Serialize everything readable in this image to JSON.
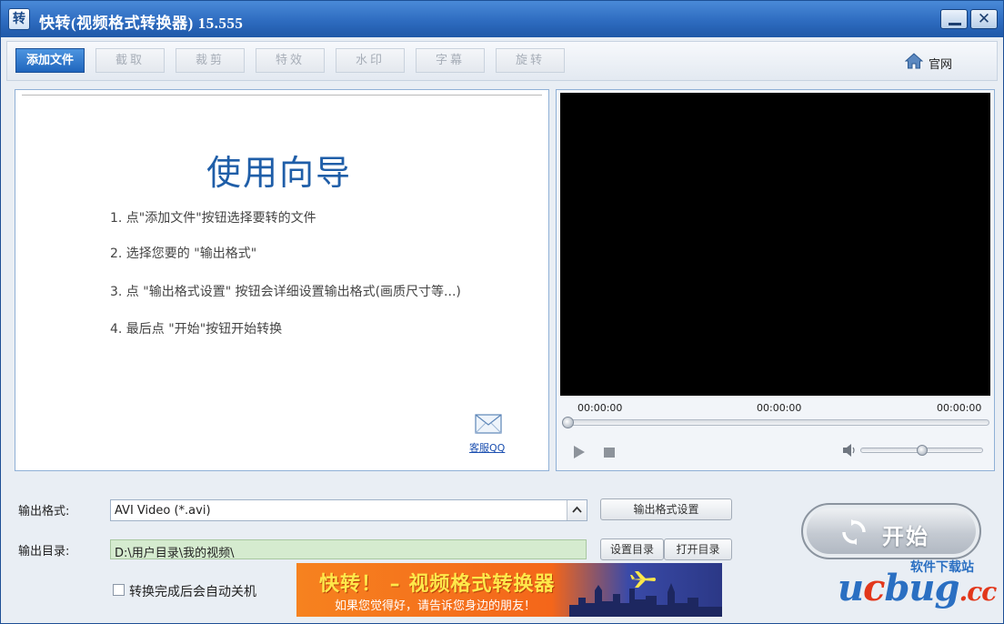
{
  "window": {
    "title": "快转(视频格式转换器) 15.555",
    "icon_glyph": "转"
  },
  "toolbar": {
    "add_file": "添加文件",
    "clip": "截取",
    "crop": "裁剪",
    "effects": "特效",
    "watermark": "水印",
    "subtitles": "字幕",
    "rotate": "旋转",
    "website": "官网"
  },
  "guide": {
    "title": "使用向导",
    "steps": [
      "1. 点\"添加文件\"按钮选择要转的文件",
      "2. 选择您要的 \"输出格式\"",
      "3. 点 \"输出格式设置\" 按钮会详细设置输出格式(画质尺寸等...)",
      "4. 最后点 \"开始\"按钮开始转换"
    ],
    "support_link": "客服QQ"
  },
  "player": {
    "time_current": "00:00:00",
    "time_middle": "00:00:00",
    "time_total": "00:00:00",
    "progress": 0,
    "volume": 0.5
  },
  "output": {
    "format_label": "输出格式:",
    "format_value": "AVI Video (*.avi)",
    "format_settings_button": "输出格式设置",
    "dir_label": "输出目录:",
    "dir_value": "D:\\用户目录\\我的视频\\",
    "set_dir_button": "设置目录",
    "open_dir_button": "打开目录",
    "shutdown_checkbox": "转换完成后会自动关机",
    "shutdown_checked": false
  },
  "start_button": "开始",
  "banner": {
    "title": "快转！ – 视频格式转换器",
    "subtitle": "如果您觉得好，请告诉您身边的朋友！"
  },
  "watermark": {
    "top": "软件下载站",
    "u": "u",
    "c": "c",
    "bug": "bug",
    "cc": ".cc"
  },
  "colors": {
    "titlebar": "#2e6cc0",
    "accent": "#1f5ea8",
    "banner_orange": "#f4661a",
    "banner_yellow": "#ffe84a",
    "dir_field_bg": "#d5ebcf"
  }
}
